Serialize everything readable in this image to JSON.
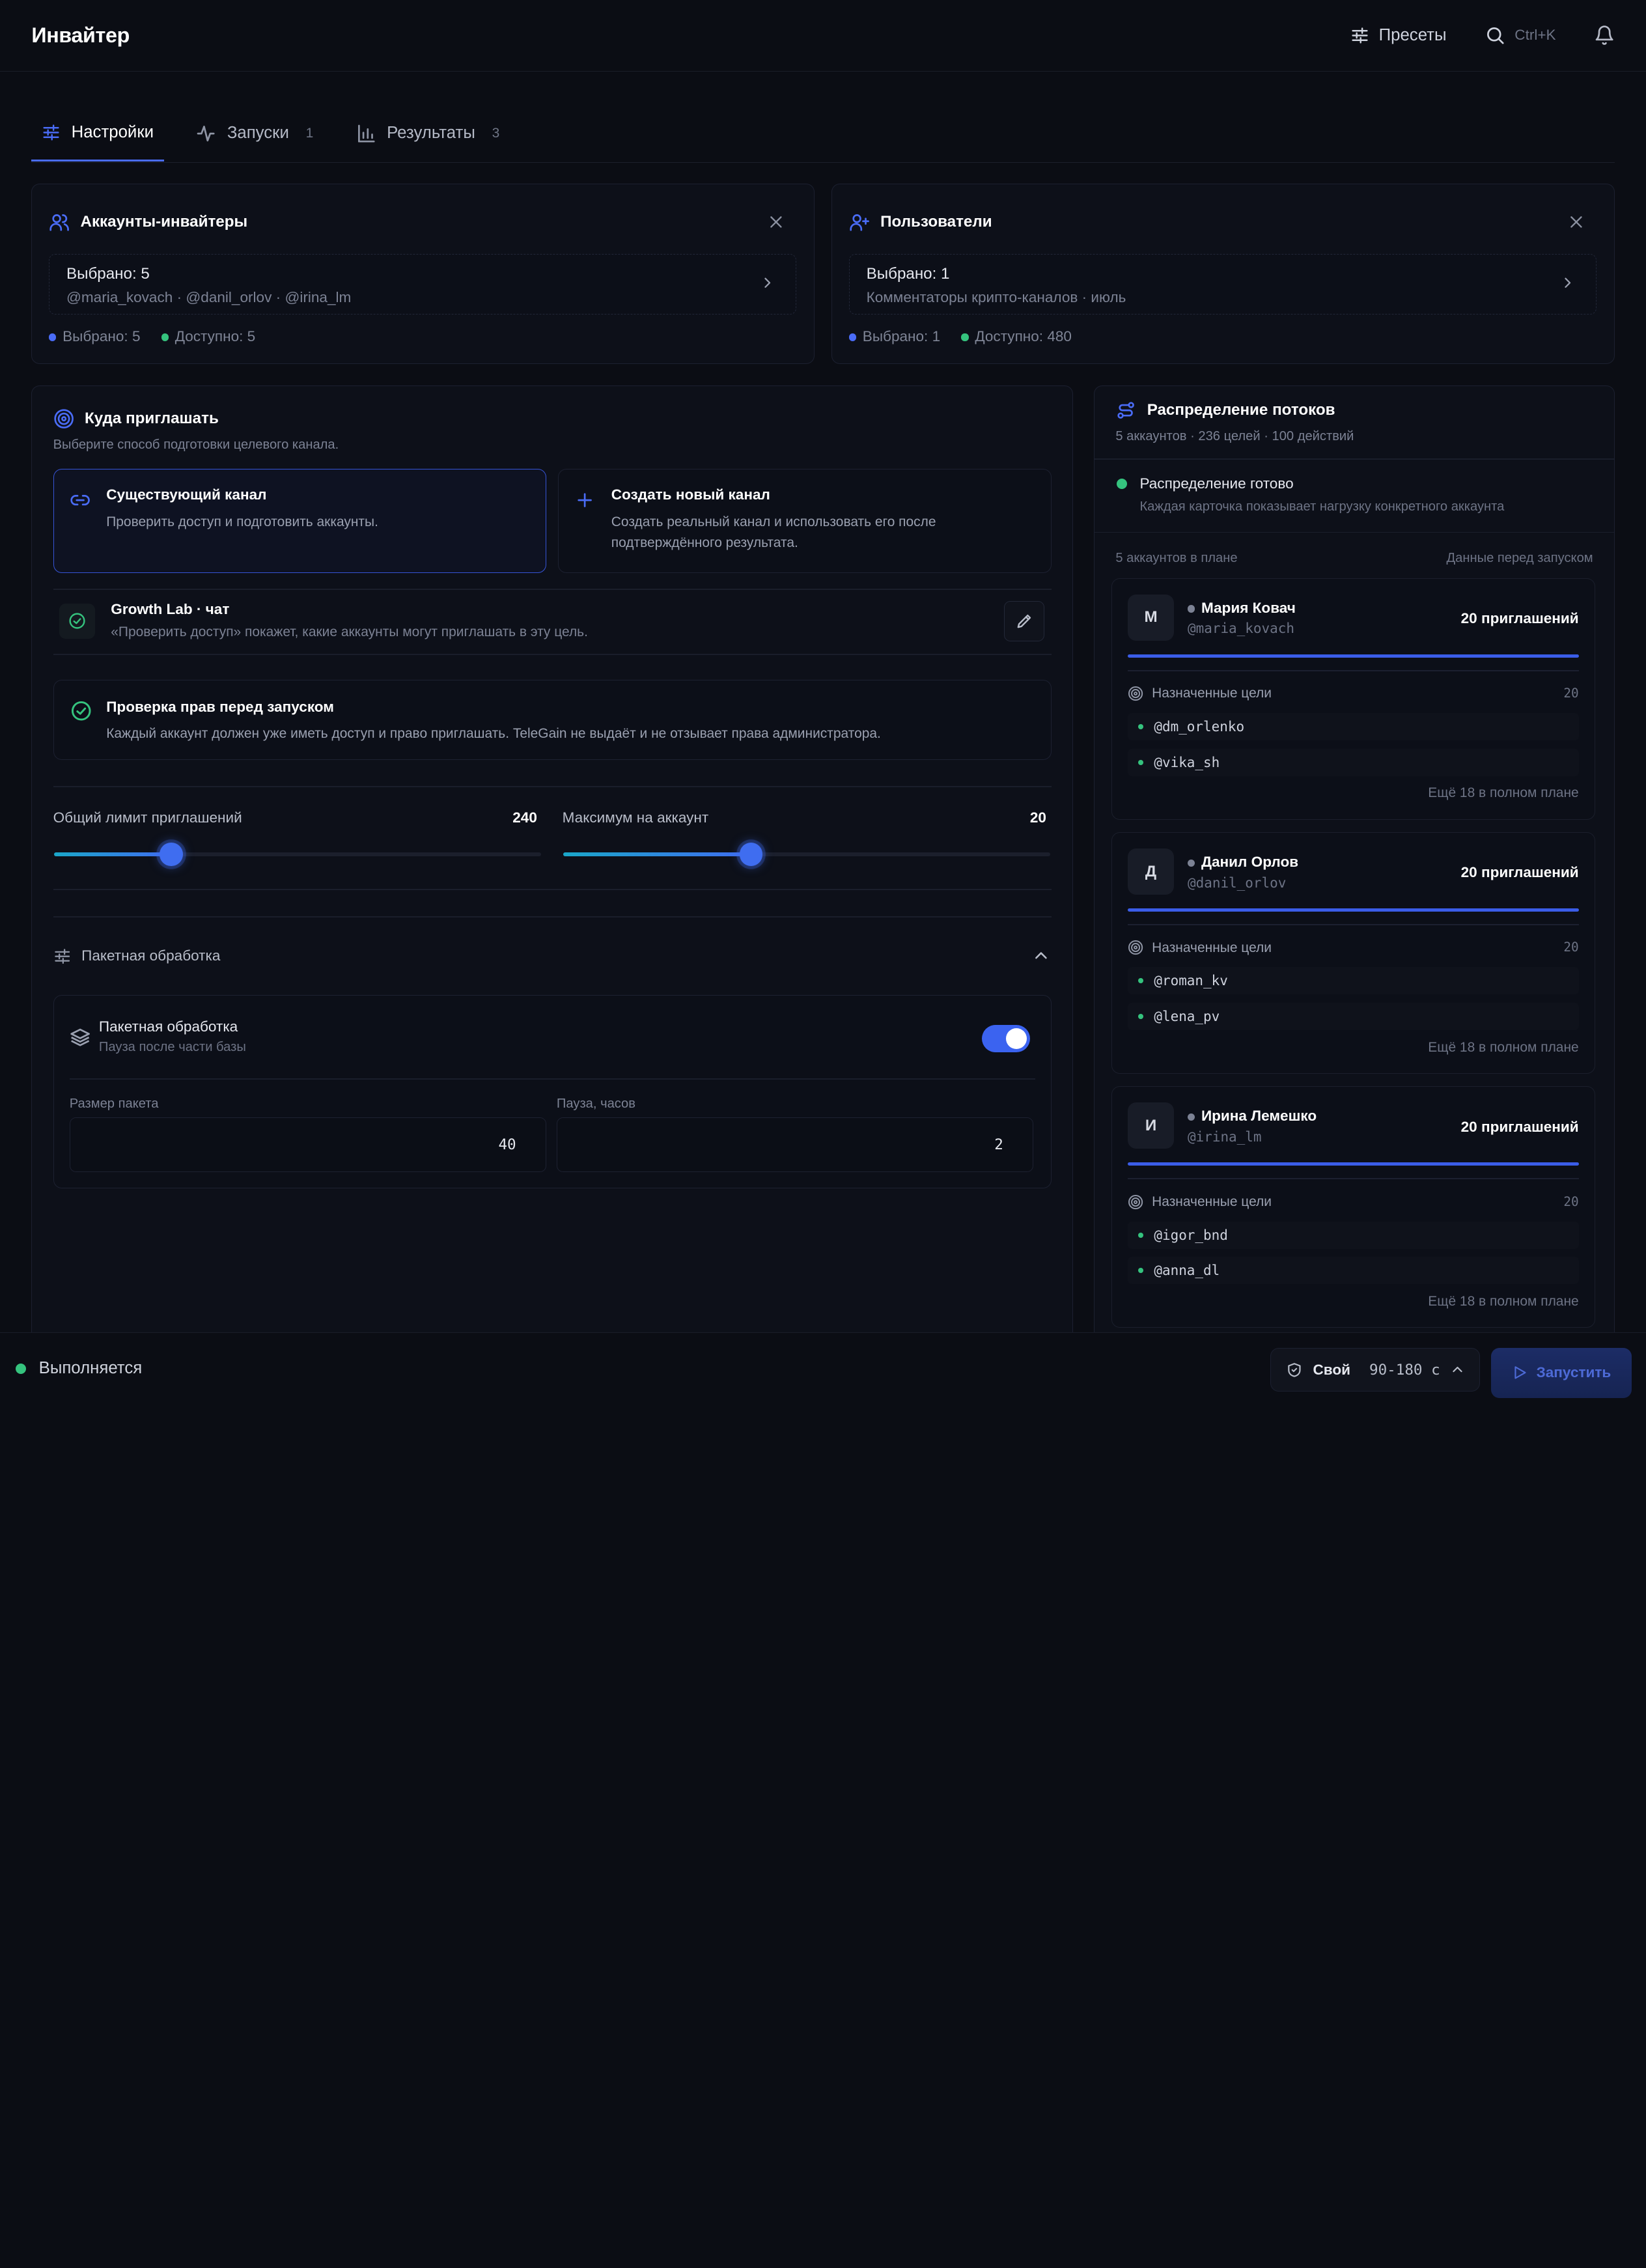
{
  "header": {
    "title": "Инвайтер",
    "presets_label": "Пресеты",
    "search_shortcut": "Ctrl+K"
  },
  "tabs": [
    {
      "label": "Настройки",
      "count": ""
    },
    {
      "label": "Запуски",
      "count": "1"
    },
    {
      "label": "Результаты",
      "count": "3"
    }
  ],
  "inviters": {
    "title": "Аккаунты-инвайтеры",
    "selected_main": "Выбрано: 5",
    "selected_sub": "@maria_kovach · @danil_orlov · @irina_lm",
    "stat_selected": "Выбрано: 5",
    "stat_available": "Доступно: 5"
  },
  "users": {
    "title": "Пользователи",
    "selected_main": "Выбрано: 1",
    "selected_sub": "Комментаторы крипто-каналов · июль",
    "stat_selected": "Выбрано: 1",
    "stat_available": "Доступно: 480"
  },
  "invite": {
    "title": "Куда приглашать",
    "subtitle": "Выберите способ подготовки целевого канала.",
    "option_existing": {
      "title": "Существующий канал",
      "desc": "Проверить доступ и подготовить аккаунты."
    },
    "option_new": {
      "title": "Создать новый канал",
      "desc_line1": "Создать реальный канал и использовать его после",
      "desc_line2": "подтверждённого результата."
    },
    "channel_name": "Growth Lab · чат",
    "channel_hint": "«Проверить доступ» покажет, какие аккаунты могут приглашать в эту цель.",
    "rights_title": "Проверка прав перед запуском",
    "rights_desc": "Каждый аккаунт должен уже иметь доступ и право приглашать. TeleGain не выдаёт и не отзывает права администратора.",
    "limit_total_label": "Общий лимит приглашений",
    "limit_total_value": "240",
    "limit_total_fraction": 0.24,
    "limit_per_label": "Максимум на аккаунт",
    "limit_per_value": "20",
    "limit_per_fraction": 0.385,
    "batch_section_label": "Пакетная обработка",
    "batch_title": "Пакетная обработка",
    "batch_sub": "Пауза после части базы",
    "batch_enabled": true,
    "batch_size_label": "Размер пакета",
    "batch_size_value": "40",
    "pause_label": "Пауза, часов",
    "pause_value": "2"
  },
  "distribution": {
    "title": "Распределение потоков",
    "subtitle": "5 аккаунтов · 236 целей · 100 действий",
    "ready_title": "Распределение готово",
    "ready_desc": "Каждая карточка показывает нагрузку конкретного аккаунта",
    "plan_label": "5 аккаунтов в плане",
    "plan_note": "Данные перед запуском",
    "targets_label": "Назначенные цели",
    "accounts": [
      {
        "initial": "М",
        "name": "Мария Ковач",
        "handle": "@maria_kovach",
        "invites": "20 приглашений",
        "targets_count": "20",
        "targets": [
          "@dm_orlenko",
          "@vika_sh"
        ],
        "more": "Ещё 18 в полном плане"
      },
      {
        "initial": "Д",
        "name": "Данил Орлов",
        "handle": "@danil_orlov",
        "invites": "20 приглашений",
        "targets_count": "20",
        "targets": [
          "@roman_kv",
          "@lena_pv"
        ],
        "more": "Ещё 18 в полном плане"
      },
      {
        "initial": "И",
        "name": "Ирина Лемешко",
        "handle": "@irina_lm",
        "invites": "20 приглашений",
        "targets_count": "20",
        "targets": [
          "@igor_bnd",
          "@anna_dl"
        ],
        "more": "Ещё 18 в полном плане"
      }
    ]
  },
  "footer": {
    "status": "Выполняется",
    "mode": "Свой",
    "interval": "90-180 с",
    "run_label": "Запустить"
  },
  "colors": {
    "accent": "#4a6cf7",
    "success": "#35c37e",
    "background": "#0b0d14"
  }
}
